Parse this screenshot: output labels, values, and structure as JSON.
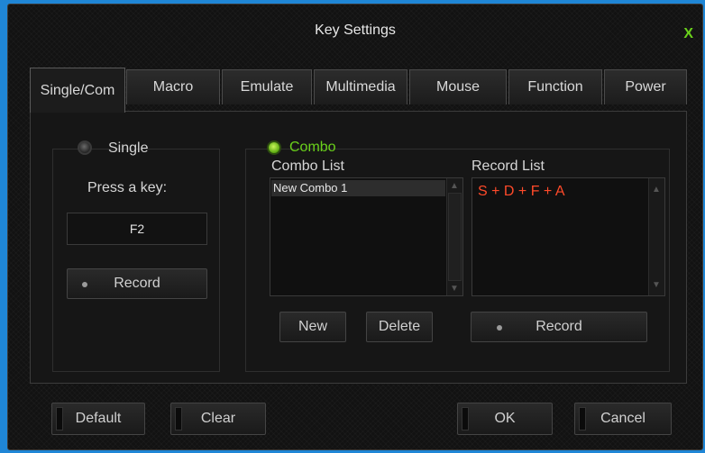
{
  "window": {
    "title": "Key Settings",
    "close_label": "X"
  },
  "tabs": [
    {
      "label": "Single/Com"
    },
    {
      "label": "Macro"
    },
    {
      "label": "Emulate"
    },
    {
      "label": "Multimedia"
    },
    {
      "label": "Mouse"
    },
    {
      "label": "Function"
    },
    {
      "label": "Power"
    }
  ],
  "single": {
    "label": "Single",
    "prompt": "Press a key:",
    "key_value": "F2",
    "record_label": "Record"
  },
  "combo": {
    "label": "Combo",
    "combo_list_label": "Combo List",
    "combo_items": [
      "New Combo 1"
    ],
    "record_list_label": "Record List",
    "record_items": [
      "S + D + F + A"
    ],
    "new_label": "New",
    "delete_label": "Delete",
    "record_label": "Record"
  },
  "footer": {
    "default_label": "Default",
    "clear_label": "Clear",
    "ok_label": "OK",
    "cancel_label": "Cancel"
  },
  "colors": {
    "accent_green": "#6ad11b",
    "record_text": "#ff4a2a",
    "window_bg": "#121212",
    "desktop_blue": "#1f86d6"
  }
}
